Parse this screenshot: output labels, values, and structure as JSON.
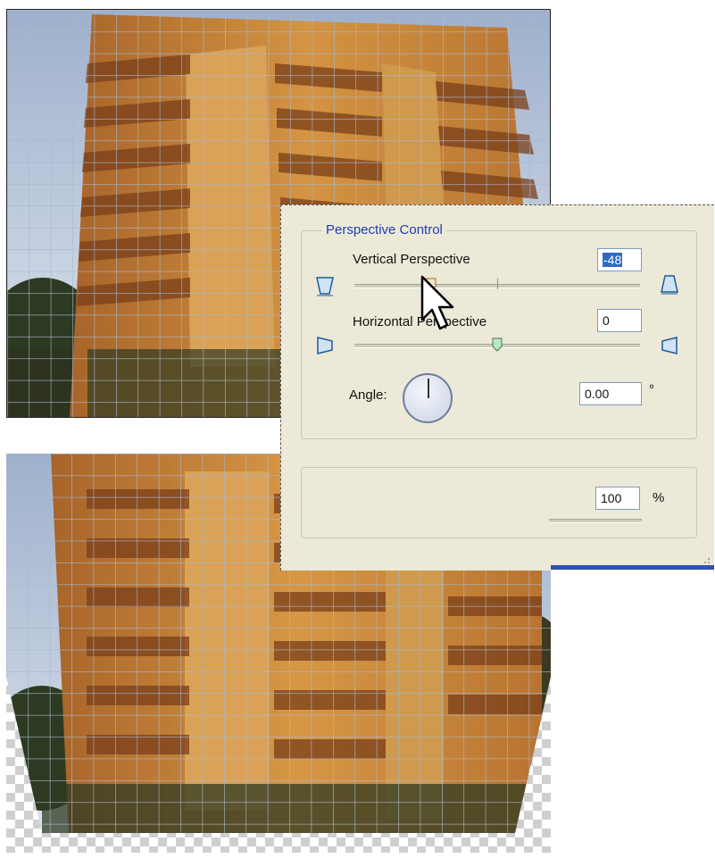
{
  "dialog": {
    "group_title": "Perspective Control",
    "vertical": {
      "label": "Vertical Perspective",
      "value": "-48",
      "slider_level": 0.27,
      "icon_left": "vertical-perspective-narrow-top-icon",
      "icon_right": "vertical-perspective-narrow-bottom-icon"
    },
    "horizontal": {
      "label": "Horizontal Perspective",
      "value": "0",
      "slider_level": 0.5,
      "icon_left": "horizontal-perspective-left-icon",
      "icon_right": "horizontal-perspective-right-icon"
    },
    "angle": {
      "label": "Angle:",
      "value": "0.00",
      "unit": "°"
    },
    "scale": {
      "value": "100",
      "unit": "%"
    }
  },
  "colors": {
    "dialog_bg": "#ece9d8",
    "group_title": "#1f3fa8",
    "selection": "#316ac5",
    "grid": "#8fa3bd",
    "building": "#c9852f"
  }
}
